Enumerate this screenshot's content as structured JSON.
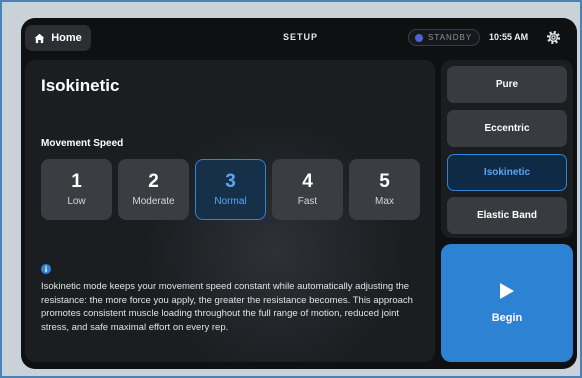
{
  "topbar": {
    "home_label": "Home",
    "title": "SETUP",
    "status": "STANDBY",
    "time": "10:55 AM"
  },
  "main": {
    "mode_title": "Isokinetic",
    "speed_label": "Movement Speed",
    "speeds": [
      {
        "num": "1",
        "label": "Low"
      },
      {
        "num": "2",
        "label": "Moderate"
      },
      {
        "num": "3",
        "label": "Normal"
      },
      {
        "num": "4",
        "label": "Fast"
      },
      {
        "num": "5",
        "label": "Max"
      }
    ],
    "selected_speed": "3",
    "description": "Isokinetic mode keeps your movement speed constant while automatically adjusting the resistance: the more force you apply, the greater the resistance becomes. This approach promotes consistent muscle loading throughout the full range of motion, reduced joint stress, and safe maximal effort on every rep."
  },
  "modes": [
    {
      "label": "Pure"
    },
    {
      "label": "Eccentric"
    },
    {
      "label": "Isokinetic"
    },
    {
      "label": "Elastic Band"
    }
  ],
  "selected_mode": "Isokinetic",
  "begin_label": "Begin",
  "colors": {
    "accent": "#2d82d4",
    "selected_text": "#58a8f2",
    "status_dot": "#4c64d8"
  },
  "icons": {
    "home": "home-icon",
    "settings": "gear-icon",
    "info": "info-icon",
    "begin": "play-icon"
  }
}
